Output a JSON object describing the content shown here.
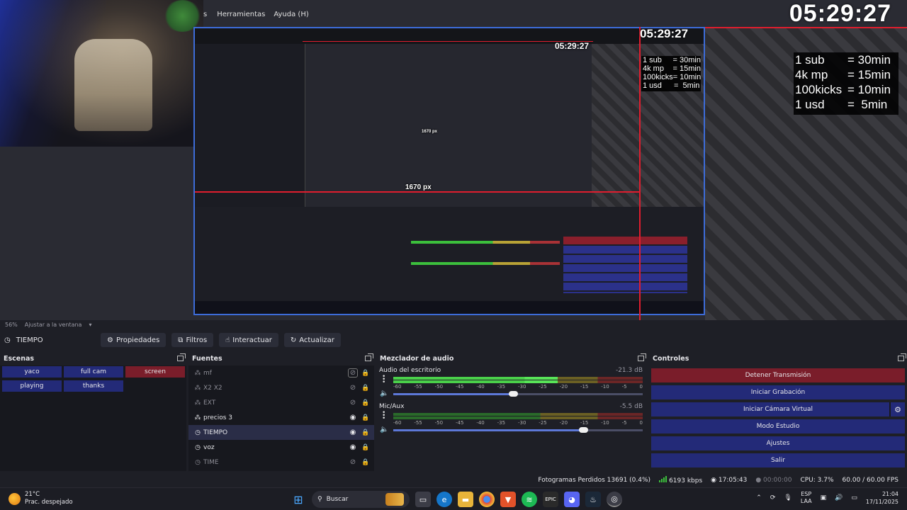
{
  "window": {
    "menu": [
      "Herramientas",
      "Ayuda (H)"
    ],
    "menu_first_fragment": "s"
  },
  "preview": {
    "clock_big": "05:29:27",
    "clock_mid": "05:29:27",
    "clock_small": "05:29:27",
    "px_label": "1670 px",
    "px_label_small": "1670 px",
    "rates": [
      {
        "k": "1 sub",
        "v": "= 30min"
      },
      {
        "k": "4k mp",
        "v": "= 15min"
      },
      {
        "k": "100kicks",
        "v": "= 10min"
      },
      {
        "k": "1 usd",
        "v": "=  5min"
      }
    ],
    "colors": {
      "selection": "#3d6cd9",
      "guide": "#e01d2e"
    }
  },
  "zoom": {
    "value": "56%",
    "mode": "Ajustar a la ventana"
  },
  "scene_bar": {
    "current_scene": "TIEMPO",
    "buttons": [
      {
        "label": "Propiedades",
        "icon": "gear-icon"
      },
      {
        "label": "Filtros",
        "icon": "filter-icon"
      },
      {
        "label": "Interactuar",
        "icon": "hand-icon"
      },
      {
        "label": "Actualizar",
        "icon": "refresh-icon"
      }
    ]
  },
  "scenes": {
    "title": "Escenas",
    "items": [
      {
        "label": "yaco",
        "active": false
      },
      {
        "label": "full cam",
        "active": false
      },
      {
        "label": "screen",
        "active": true
      },
      {
        "label": "playing",
        "active": false
      },
      {
        "label": "thanks",
        "active": false
      }
    ]
  },
  "sources": {
    "title": "Fuentes",
    "items": [
      {
        "label": "mf",
        "visible": false,
        "selected": false,
        "icon": "source-icon"
      },
      {
        "label": "X2 X2",
        "visible": false,
        "selected": false,
        "icon": "source-icon"
      },
      {
        "label": "EXT",
        "visible": false,
        "selected": false,
        "icon": "source-icon"
      },
      {
        "label": "precios 3",
        "visible": true,
        "selected": false,
        "icon": "source-icon"
      },
      {
        "label": "TIEMPO",
        "visible": true,
        "selected": true,
        "icon": "clock-icon"
      },
      {
        "label": "voz",
        "visible": true,
        "selected": false,
        "icon": "clock-icon"
      },
      {
        "label": "TIME",
        "visible": false,
        "selected": false,
        "icon": "clock-icon"
      }
    ]
  },
  "mixer": {
    "title": "Mezclador de audio",
    "scale": [
      "-60",
      "-55",
      "-50",
      "-45",
      "-40",
      "-35",
      "-30",
      "-25",
      "-20",
      "-15",
      "-10",
      "-5",
      "0"
    ],
    "channels": [
      {
        "name": "Audio del escritorio",
        "db": "-21.3 dB",
        "level": 0.66,
        "volume": 0.48
      },
      {
        "name": "Mic/Aux",
        "db": "-5.5 dB",
        "level": 0.0,
        "volume": 0.76
      }
    ]
  },
  "controls": {
    "title": "Controles",
    "buttons": [
      {
        "label": "Detener Transmisión",
        "kind": "stream"
      },
      {
        "label": "Iniciar Grabación",
        "kind": "normal"
      },
      {
        "label": "Iniciar Cámara Virtual",
        "kind": "normal"
      },
      {
        "label": "Modo Estudio",
        "kind": "normal"
      },
      {
        "label": "Ajustes",
        "kind": "normal"
      },
      {
        "label": "Salir",
        "kind": "normal"
      }
    ]
  },
  "status": {
    "dropped": "Fotogramas Perdidos 13691 (0.4%)",
    "bitrate": "6193 kbps",
    "stream_time": "17:05:43",
    "rec_time": "00:00:00",
    "cpu": "CPU: 3.7%",
    "fps": "60.00 / 60.00 FPS"
  },
  "taskbar": {
    "weather_temp": "21°C",
    "weather_desc": "Prac. despejado",
    "search_placeholder": "Buscar",
    "lang_top": "ESP",
    "lang_bottom": "LAA",
    "time": "21:04",
    "date": "17/11/2025"
  }
}
